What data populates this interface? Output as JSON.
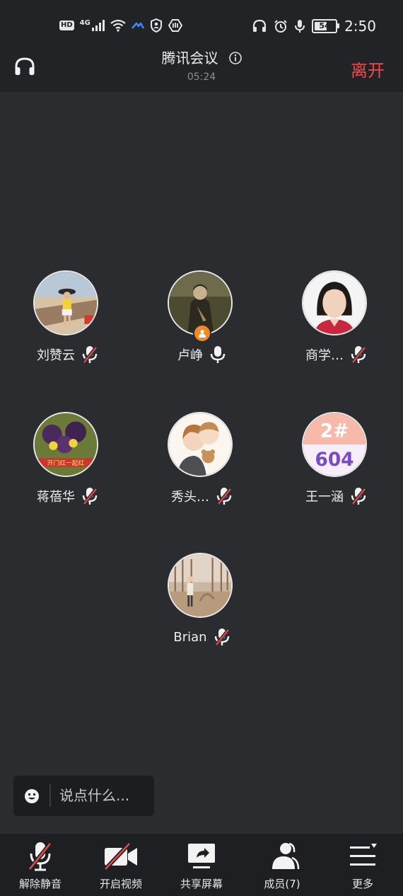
{
  "status_bar": {
    "hd": "HD",
    "network": "4G",
    "battery": "54",
    "time": "2:50"
  },
  "header": {
    "title": "腾讯会议",
    "timer": "05:24",
    "leave_label": "离开"
  },
  "participants": [
    {
      "name": "刘赞云",
      "mic": "muted",
      "host": false
    },
    {
      "name": "卢峥",
      "mic": "on",
      "host": true
    },
    {
      "name": "商学…",
      "mic": "muted",
      "host": false
    },
    {
      "name": "蒋蓓华",
      "mic": "muted",
      "host": false
    },
    {
      "name": "秀头…",
      "mic": "muted",
      "host": false
    },
    {
      "name": "王一涵",
      "mic": "muted",
      "host": false
    },
    {
      "name": "Brian",
      "mic": "muted",
      "host": false
    }
  ],
  "avatar_text": {
    "p3_banner": "开门红一起红",
    "p6_top": "2#",
    "p6_bottom": "604"
  },
  "chat": {
    "placeholder": "说点什么..."
  },
  "toolbar": [
    {
      "label": "解除静音",
      "icon": "mic-muted-icon"
    },
    {
      "label": "开启视频",
      "icon": "video-off-icon"
    },
    {
      "label": "共享屏幕",
      "icon": "share-screen-icon"
    },
    {
      "label": "成员(7)",
      "icon": "members-icon"
    },
    {
      "label": "更多",
      "icon": "more-menu-icon"
    }
  ],
  "colors": {
    "background": "#2b2c30",
    "bar": "#222327",
    "leave": "#ee4b4b",
    "host_badge": "#f08a24",
    "muted_slash": "#e04848"
  }
}
